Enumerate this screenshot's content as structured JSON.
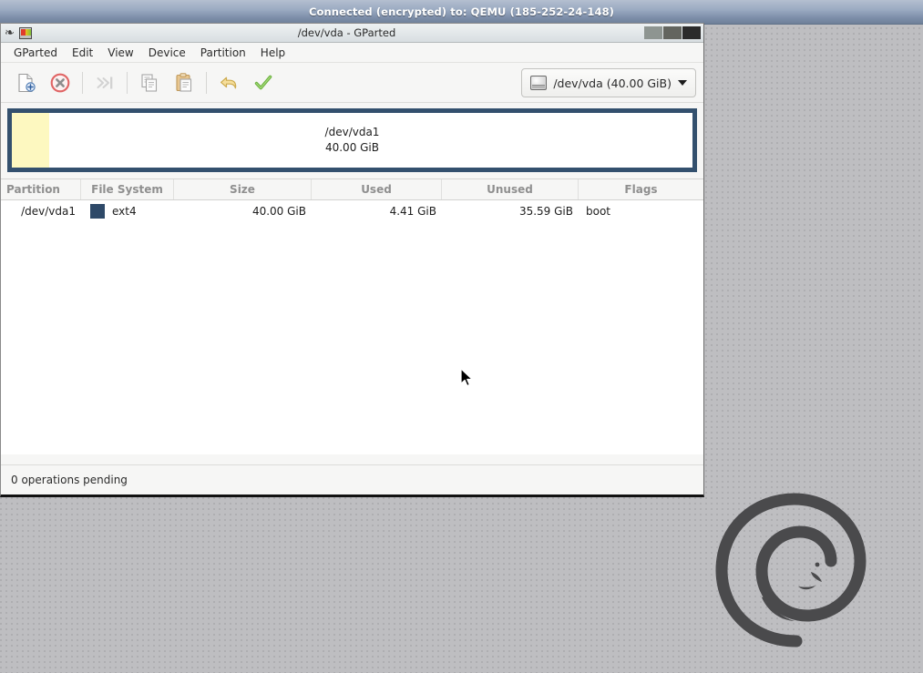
{
  "vnc": {
    "status_text": "Connected (encrypted) to: QEMU (185-252-24-148)"
  },
  "window": {
    "title": "/dev/vda - GParted",
    "icon_name": "gparted-app-icon",
    "spiral_glyph": "❧",
    "buttons": {
      "minimize": "minimize",
      "maximize": "maximize",
      "close": "close"
    }
  },
  "menubar": {
    "items": [
      {
        "label": "GParted"
      },
      {
        "label": "Edit"
      },
      {
        "label": "View"
      },
      {
        "label": "Device"
      },
      {
        "label": "Partition"
      },
      {
        "label": "Help"
      }
    ]
  },
  "toolbar": {
    "buttons": [
      {
        "name": "new-partition",
        "label": "New",
        "enabled": true
      },
      {
        "name": "delete-partition",
        "label": "Delete",
        "enabled": true
      },
      {
        "name": "resize-move-partition",
        "label": "Resize/Move",
        "enabled": false
      },
      {
        "name": "copy-partition",
        "label": "Copy",
        "enabled": true
      },
      {
        "name": "paste-partition",
        "label": "Paste",
        "enabled": true
      },
      {
        "name": "undo-operation",
        "label": "Undo",
        "enabled": true
      },
      {
        "name": "apply-operations",
        "label": "Apply",
        "enabled": true
      }
    ],
    "device_selector": {
      "label": "/dev/vda (40.00 GiB)",
      "icon_name": "hard-disk-icon"
    }
  },
  "graphic": {
    "partition_name": "/dev/vda1",
    "partition_size": "40.00 GiB",
    "used_color": "#fdf8c0",
    "unused_color": "#ffffff",
    "border_color": "#33506e"
  },
  "table": {
    "columns": [
      {
        "key": "partition",
        "label": "Partition"
      },
      {
        "key": "filesystem",
        "label": "File System"
      },
      {
        "key": "size",
        "label": "Size"
      },
      {
        "key": "used",
        "label": "Used"
      },
      {
        "key": "unused",
        "label": "Unused"
      },
      {
        "key": "flags",
        "label": "Flags"
      }
    ],
    "rows": [
      {
        "partition": "/dev/vda1",
        "filesystem": "ext4",
        "filesystem_color": "#2e4968",
        "size": "40.00 GiB",
        "used": "4.41 GiB",
        "unused": "35.59 GiB",
        "flags": "boot"
      }
    ]
  },
  "statusbar": {
    "text": "0 operations pending"
  },
  "desktop": {
    "logo_name": "debian-swirl-logo",
    "background_color": "#bebec1"
  }
}
